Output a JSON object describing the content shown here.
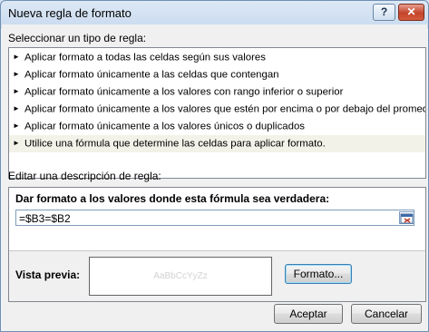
{
  "window": {
    "title": "Nueva regla de formato",
    "help_glyph": "?",
    "close_glyph": "✕"
  },
  "section1": {
    "label": "Seleccionar un tipo de regla:"
  },
  "rules": [
    {
      "label": "Aplicar formato a todas las celdas según sus valores"
    },
    {
      "label": "Aplicar formato únicamente a las celdas que contengan"
    },
    {
      "label": "Aplicar formato únicamente a los valores con rango inferior o superior"
    },
    {
      "label": "Aplicar formato únicamente a los valores que estén por encima o por debajo del promedio"
    },
    {
      "label": "Aplicar formato únicamente a los valores únicos o duplicados"
    },
    {
      "label": "Utilice una fórmula que determine las celdas para aplicar formato."
    }
  ],
  "selected_rule_index": 5,
  "arrow_glyph": "►",
  "section2": {
    "label": "Editar una descripción de regla:"
  },
  "description": {
    "heading": "Dar formato a los valores donde esta fórmula sea verdadera:",
    "formula_value": "=$B3=$B2",
    "preview_label": "Vista previa:",
    "preview_sample": "AaBbCcYyZz",
    "format_button": "Formato..."
  },
  "buttons": {
    "ok": "Aceptar",
    "cancel": "Cancelar"
  },
  "colors": {
    "selected_row": "#f2f2e8",
    "window_border": "#6f8fb4",
    "close_button": "#c4432b"
  }
}
